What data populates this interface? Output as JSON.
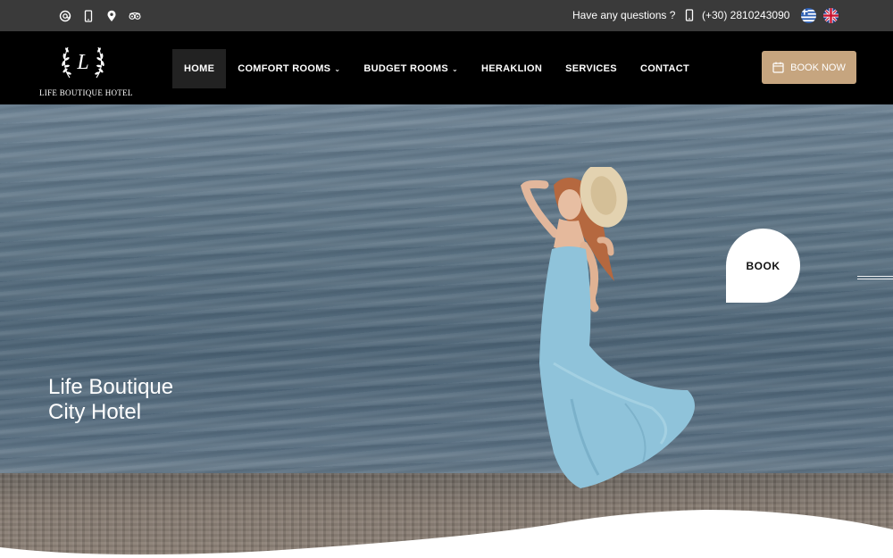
{
  "topbar": {
    "icons": [
      "at-icon",
      "mobile-icon",
      "location-pin-icon",
      "tripadvisor-icon"
    ],
    "question": "Have any questions ?",
    "phone": "(+30) 2810243090",
    "languages": [
      "Greek",
      "English"
    ]
  },
  "logo": {
    "monogram": "L",
    "text": "LIFE BOUTIQUE HOTEL"
  },
  "nav": {
    "items": [
      {
        "label": "HOME",
        "active": true,
        "dropdown": false
      },
      {
        "label": "COMFORT ROOMS",
        "active": false,
        "dropdown": true
      },
      {
        "label": "BUDGET ROOMS",
        "active": false,
        "dropdown": true
      },
      {
        "label": "HERAKLION",
        "active": false,
        "dropdown": false
      },
      {
        "label": "SERVICES",
        "active": false,
        "dropdown": false
      },
      {
        "label": "CONTACT",
        "active": false,
        "dropdown": false
      }
    ],
    "caret": "⌄",
    "book_now": "BOOK NOW"
  },
  "hero": {
    "title_line1": "Life Boutique",
    "title_line2": "City Hotel",
    "book_bubble": "BOOK"
  },
  "colors": {
    "topbar_bg": "#3a3a3a",
    "navbar_bg": "#000000",
    "accent": "#c6a57f"
  }
}
